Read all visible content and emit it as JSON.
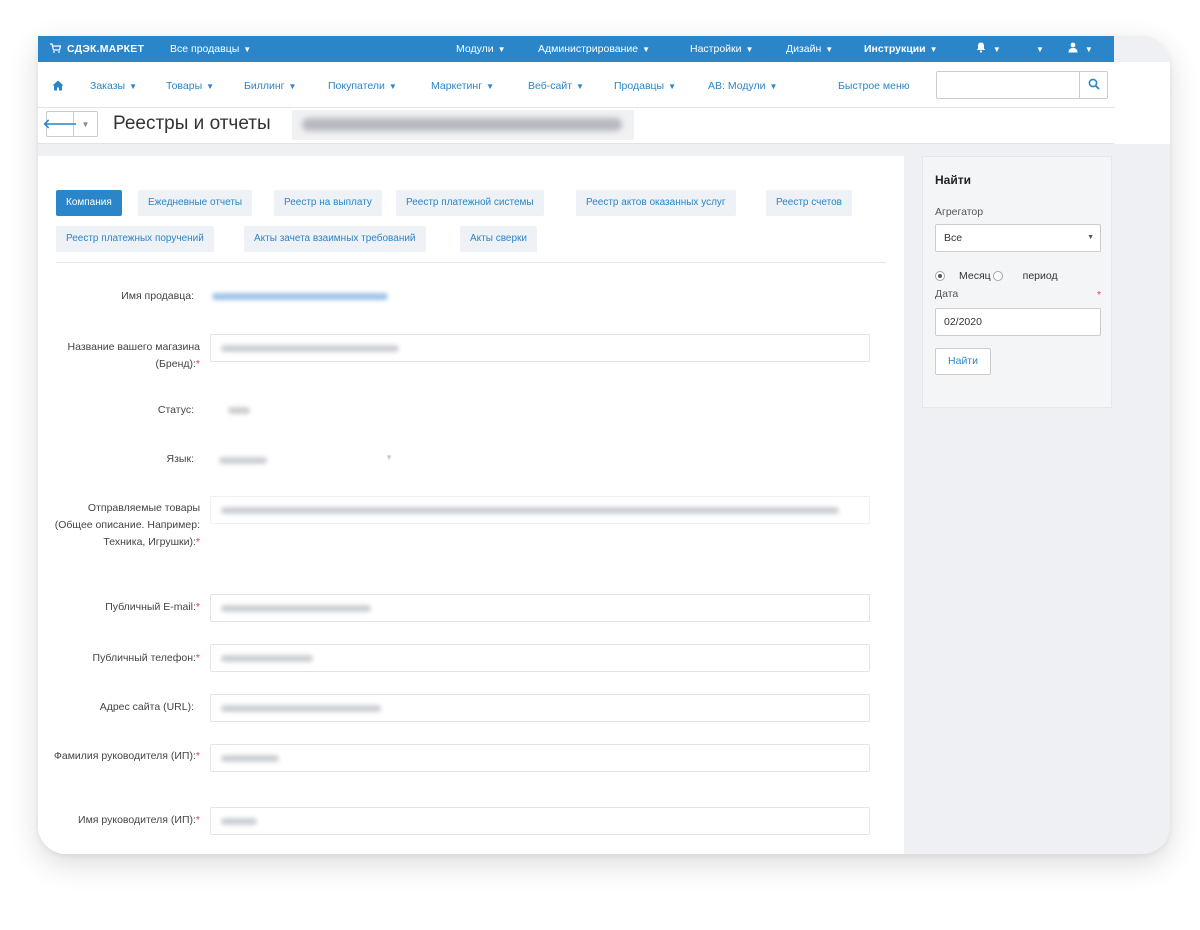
{
  "topbar": {
    "brand": "СДЭК.МАРКЕТ",
    "vendors": "Все продавцы",
    "menu": [
      {
        "label": "Модули"
      },
      {
        "label": "Администрирование"
      },
      {
        "label": "Настройки"
      },
      {
        "label": "Дизайн"
      },
      {
        "label": "Инструкции"
      }
    ]
  },
  "navbar": {
    "items": [
      {
        "label": "Заказы"
      },
      {
        "label": "Товары"
      },
      {
        "label": "Биллинг"
      },
      {
        "label": "Покупатели"
      },
      {
        "label": "Маркетинг"
      },
      {
        "label": "Веб-сайт"
      },
      {
        "label": "Продавцы"
      },
      {
        "label": "AB: Модули"
      }
    ],
    "quick_menu": "Быстрое меню",
    "search_placeholder": ""
  },
  "title": {
    "text": "Реестры и отчеты"
  },
  "tabs": [
    {
      "label": "Компания",
      "active": true
    },
    {
      "label": "Ежедневные отчеты",
      "active": false
    },
    {
      "label": "Реестр на выплату",
      "active": false
    },
    {
      "label": "Реестр платежной системы",
      "active": false
    },
    {
      "label": "Реестр актов оказанных услуг",
      "active": false
    },
    {
      "label": "Реестр счетов",
      "active": false
    },
    {
      "label": "Реестр платежных поручений",
      "active": false
    },
    {
      "label": "Акты зачета взаимных требований",
      "active": false
    },
    {
      "label": "Акты сверки",
      "active": false
    }
  ],
  "form": {
    "fields": [
      {
        "label": "Имя продавца:"
      },
      {
        "label": "Название вашего магазина (Бренд):"
      },
      {
        "label": "Статус:"
      },
      {
        "label": "Язык:"
      },
      {
        "label": "Отправляемые товары (Общее описание. Например: Техника, Игрушки):"
      },
      {
        "label": "Публичный E-mail:"
      },
      {
        "label": "Публичный телефон:"
      },
      {
        "label": "Адрес сайта (URL):"
      },
      {
        "label": "Фамилия руководителя (ИП):"
      },
      {
        "label": "Имя руководителя (ИП):"
      }
    ]
  },
  "side": {
    "title": "Найти",
    "aggregator_label": "Агрегатор",
    "aggregator_value": "Все",
    "radio_month": "Месяц",
    "radio_period": "период",
    "date_label": "Дата",
    "date_value": "02/2020",
    "find_button": "Найти"
  },
  "colors": {
    "accent": "#2a86c9",
    "required": "#e03a3a",
    "panel_bg": "#eef0f3"
  }
}
